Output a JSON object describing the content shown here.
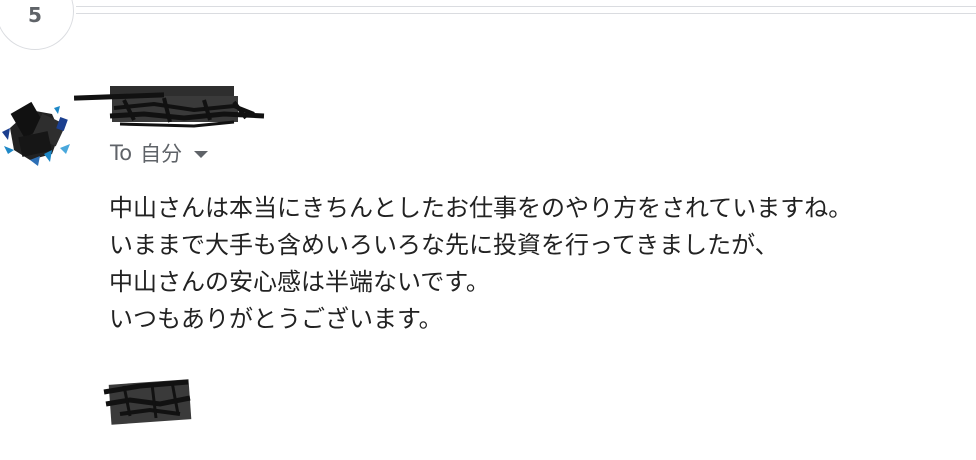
{
  "thread": {
    "message_count": "5"
  },
  "message": {
    "sender_name": "",
    "recipient_prefix": "To",
    "recipient": "自分",
    "body_lines": [
      "中山さんは本当にきちんとしたお仕事をのやり方をされていますね。",
      "いままで大手も含めいろいろな先に投資を行ってきましたが、",
      "中山さんの安心感は半端ないです。",
      "いつもありがとうございます。"
    ]
  },
  "icons": {
    "recipient_details": "chevron-down-icon"
  },
  "colors": {
    "body_text": "#222222",
    "secondary_text": "#5f6368",
    "divider": "#dadce0",
    "redaction": "#1a1a1a",
    "avatar_accent": "#1e88c7"
  }
}
